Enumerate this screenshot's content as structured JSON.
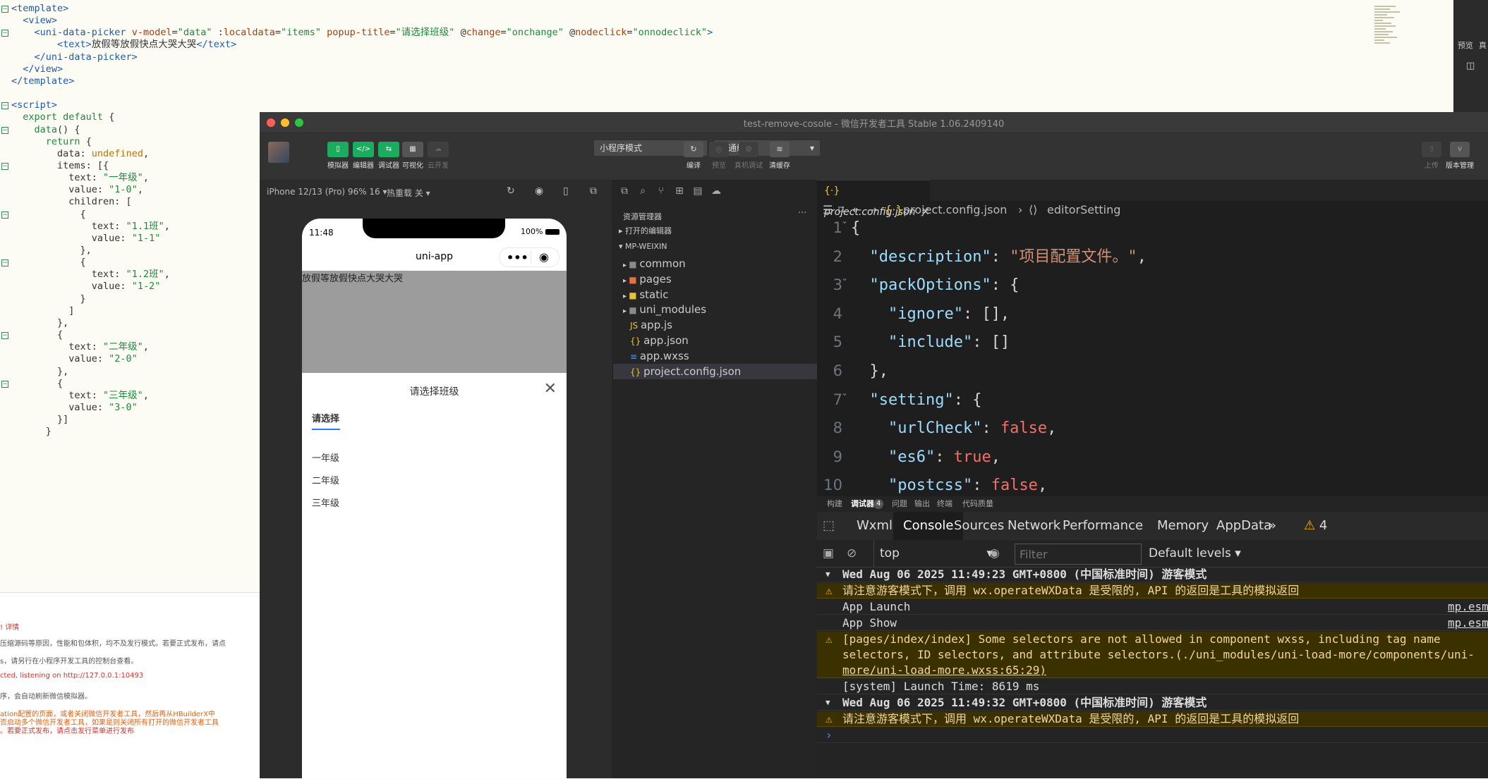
{
  "background_editor": {
    "lines": [
      {
        "parts": [
          [
            "tag",
            "<template>"
          ]
        ]
      },
      {
        "parts": [
          [
            "plain",
            "  "
          ],
          [
            "tag",
            "<view>"
          ]
        ]
      },
      {
        "parts": [
          [
            "plain",
            "    "
          ],
          [
            "tag",
            "<uni-data-picker "
          ],
          [
            "attr",
            "v-model"
          ],
          [
            "plain",
            "="
          ],
          [
            "str",
            "\"data\""
          ],
          [
            "plain",
            " :"
          ],
          [
            "attr",
            "localdata"
          ],
          [
            "plain",
            "="
          ],
          [
            "str",
            "\"items\""
          ],
          [
            "plain",
            " "
          ],
          [
            "attr",
            "popup-title"
          ],
          [
            "plain",
            "="
          ],
          [
            "str",
            "\"请选择班级\""
          ],
          [
            "plain",
            " @"
          ],
          [
            "attr",
            "change"
          ],
          [
            "plain",
            "="
          ],
          [
            "str",
            "\"onchange\""
          ],
          [
            "plain",
            " @"
          ],
          [
            "attr",
            "nodeclick"
          ],
          [
            "plain",
            "="
          ],
          [
            "str",
            "\"onnodeclick\""
          ],
          [
            "tag",
            ">"
          ]
        ]
      },
      {
        "parts": [
          [
            "plain",
            "        "
          ],
          [
            "tag",
            "<text>"
          ],
          [
            "plain",
            "放假等放假快点大哭大哭"
          ],
          [
            "tag",
            "</text>"
          ]
        ]
      },
      {
        "parts": [
          [
            "plain",
            "    "
          ],
          [
            "tag",
            "</uni-data-picker>"
          ]
        ]
      },
      {
        "parts": [
          [
            "plain",
            "  "
          ],
          [
            "tag",
            "</view>"
          ]
        ]
      },
      {
        "parts": [
          [
            "tag",
            "</template>"
          ]
        ]
      },
      {
        "parts": [
          [
            "plain",
            ""
          ]
        ]
      },
      {
        "parts": [
          [
            "tag",
            "<script>"
          ]
        ]
      },
      {
        "parts": [
          [
            "plain",
            "  "
          ],
          [
            "kw",
            "export default"
          ],
          [
            "plain",
            " {"
          ]
        ]
      },
      {
        "parts": [
          [
            "plain",
            "    "
          ],
          [
            "kw",
            "data"
          ],
          [
            "plain",
            "() {"
          ]
        ]
      },
      {
        "parts": [
          [
            "plain",
            "      "
          ],
          [
            "kw",
            "return"
          ],
          [
            "plain",
            " {"
          ]
        ]
      },
      {
        "parts": [
          [
            "plain",
            "        data: "
          ],
          [
            "val",
            "undefined"
          ],
          [
            "plain",
            ","
          ]
        ]
      },
      {
        "parts": [
          [
            "plain",
            "        items: [{"
          ]
        ]
      },
      {
        "parts": [
          [
            "plain",
            "          text: "
          ],
          [
            "str",
            "\"一年级\""
          ],
          [
            "plain",
            ","
          ]
        ]
      },
      {
        "parts": [
          [
            "plain",
            "          value: "
          ],
          [
            "str",
            "\"1-0\""
          ],
          [
            "plain",
            ","
          ]
        ]
      },
      {
        "parts": [
          [
            "plain",
            "          children: ["
          ]
        ]
      },
      {
        "parts": [
          [
            "plain",
            "            {"
          ]
        ]
      },
      {
        "parts": [
          [
            "plain",
            "              text: "
          ],
          [
            "str",
            "\"1.1班\""
          ],
          [
            "plain",
            ","
          ]
        ]
      },
      {
        "parts": [
          [
            "plain",
            "              value: "
          ],
          [
            "str",
            "\"1-1\""
          ]
        ]
      },
      {
        "parts": [
          [
            "plain",
            "            },"
          ]
        ]
      },
      {
        "parts": [
          [
            "plain",
            "            {"
          ]
        ]
      },
      {
        "parts": [
          [
            "plain",
            "              text: "
          ],
          [
            "str",
            "\"1.2班\""
          ],
          [
            "plain",
            ","
          ]
        ]
      },
      {
        "parts": [
          [
            "plain",
            "              value: "
          ],
          [
            "str",
            "\"1-2\""
          ]
        ]
      },
      {
        "parts": [
          [
            "plain",
            "            }"
          ]
        ]
      },
      {
        "parts": [
          [
            "plain",
            "          ]"
          ]
        ]
      },
      {
        "parts": [
          [
            "plain",
            "        },"
          ]
        ]
      },
      {
        "parts": [
          [
            "plain",
            "        {"
          ]
        ]
      },
      {
        "parts": [
          [
            "plain",
            "          text: "
          ],
          [
            "str",
            "\"二年级\""
          ],
          [
            "plain",
            ","
          ]
        ]
      },
      {
        "parts": [
          [
            "plain",
            "          value: "
          ],
          [
            "str",
            "\"2-0\""
          ]
        ]
      },
      {
        "parts": [
          [
            "plain",
            "        },"
          ]
        ]
      },
      {
        "parts": [
          [
            "plain",
            "        {"
          ]
        ]
      },
      {
        "parts": [
          [
            "plain",
            "          text: "
          ],
          [
            "str",
            "\"三年级\""
          ],
          [
            "plain",
            ","
          ]
        ]
      },
      {
        "parts": [
          [
            "plain",
            "          value: "
          ],
          [
            "str",
            "\"3-0\""
          ]
        ]
      },
      {
        "parts": [
          [
            "plain",
            "        }]"
          ]
        ]
      },
      {
        "parts": [
          [
            "plain",
            "      }"
          ]
        ]
      }
    ],
    "console_lines": [
      {
        "text": "! 详情",
        "color": "#d0342c"
      },
      {
        "text": "压缩源码等原因，性能和包体积，均不及发行模式。若要正式发布，请点",
        "color": "#555"
      },
      {
        "text": "s，请另行在小程序开发工具的控制台查看。",
        "color": "#555"
      },
      {
        "text": "cted, listening on http://127.0.0.1:10493",
        "color": "#d0342c"
      },
      {
        "text": "序，会自动刷新微信模拟器。",
        "color": "#555"
      },
      {
        "text": "ation配置的页面，或者关闭微信开发者工具，然后再从HBuilderX中",
        "color": "#e06010"
      },
      {
        "text": "否启动多个微信开发者工具，如果是则关闭所有打开的微信开发者工具",
        "color": "#e06010"
      },
      {
        "text": "。若要正式发布，请点击发行菜单进行发布",
        "color": "#d0342c"
      }
    ],
    "right_strip": {
      "label1": "预览",
      "label2": "真"
    }
  },
  "window": {
    "title": "test-remove-cosole - 微信开发者工具 Stable 1.06.2409140",
    "toolbar": {
      "buttons": [
        {
          "icon": "phone-icon",
          "label": "模拟器"
        },
        {
          "icon": "code-icon",
          "label": "编辑器"
        },
        {
          "icon": "debug-icon",
          "label": "调试器"
        },
        {
          "icon": "layout-icon",
          "label": "可视化"
        },
        {
          "icon": "cloud-icon",
          "label": "云开发"
        }
      ],
      "mode_select": "小程序模式",
      "compile_select": "普通编译",
      "right_buttons": [
        {
          "icon": "refresh-icon",
          "label": "编译"
        },
        {
          "icon": "eye-icon",
          "label": "预览"
        },
        {
          "icon": "bug-icon",
          "label": "真机调试"
        },
        {
          "icon": "layers-icon",
          "label": "清缓存"
        }
      ],
      "far_right_buttons": [
        {
          "icon": "upload-icon",
          "label": "上传"
        },
        {
          "icon": "branch-icon",
          "label": "版本管理"
        }
      ]
    },
    "simulator": {
      "device": "iPhone 12/13 (Pro) 96% 16 ▾",
      "hot_reload": "热重载 关 ▾",
      "phone": {
        "time": "11:48",
        "battery": "100%",
        "nav_title": "uni-app",
        "content_text": "放假等放假快点大哭大哭",
        "popup_title": "请选择班级",
        "popup_tab": "请选择",
        "popup_items": [
          "一年级",
          "二年级",
          "三年级"
        ]
      }
    },
    "explorer": {
      "title": "资源管理器",
      "open_editors": "打开的编辑器",
      "project": "MP-WEIXIN",
      "items": [
        {
          "name": "common",
          "kind": "folder",
          "color": "#8a8a8a"
        },
        {
          "name": "pages",
          "kind": "folder",
          "color": "#e8703a"
        },
        {
          "name": "static",
          "kind": "folder",
          "color": "#e8c03a"
        },
        {
          "name": "uni_modules",
          "kind": "folder",
          "color": "#8a8a8a"
        },
        {
          "name": "app.js",
          "kind": "js",
          "color": "#e8c03a"
        },
        {
          "name": "app.json",
          "kind": "json",
          "color": "#e8c03a"
        },
        {
          "name": "app.wxss",
          "kind": "css",
          "color": "#4a9ae8"
        },
        {
          "name": "project.config.json",
          "kind": "json",
          "color": "#e8c03a"
        }
      ]
    },
    "editor": {
      "tab": "project.config.json",
      "crumb_file": "project.config.json",
      "crumb_sep": "›",
      "crumb_node": "editorSetting",
      "lines": [
        {
          "n": "1",
          "parts": [
            [
              "punc",
              "{"
            ]
          ]
        },
        {
          "n": "2",
          "parts": [
            [
              "punc",
              "  "
            ],
            [
              "key",
              "\"description\""
            ],
            [
              "punc",
              ": "
            ],
            [
              "str",
              "\"项目配置文件。\""
            ],
            [
              "punc",
              ","
            ]
          ]
        },
        {
          "n": "3",
          "parts": [
            [
              "punc",
              "  "
            ],
            [
              "key",
              "\"packOptions\""
            ],
            [
              "punc",
              ": {"
            ]
          ]
        },
        {
          "n": "4",
          "parts": [
            [
              "punc",
              "    "
            ],
            [
              "key",
              "\"ignore\""
            ],
            [
              "punc",
              ": [],"
            ]
          ]
        },
        {
          "n": "5",
          "parts": [
            [
              "punc",
              "    "
            ],
            [
              "key",
              "\"include\""
            ],
            [
              "punc",
              ": []"
            ]
          ]
        },
        {
          "n": "6",
          "parts": [
            [
              "punc",
              "  },"
            ]
          ]
        },
        {
          "n": "7",
          "parts": [
            [
              "punc",
              "  "
            ],
            [
              "key",
              "\"setting\""
            ],
            [
              "punc",
              ": {"
            ]
          ]
        },
        {
          "n": "8",
          "parts": [
            [
              "punc",
              "    "
            ],
            [
              "key",
              "\"urlCheck\""
            ],
            [
              "punc",
              ": "
            ],
            [
              "red",
              "false"
            ],
            [
              "punc",
              ","
            ]
          ]
        },
        {
          "n": "9",
          "parts": [
            [
              "punc",
              "    "
            ],
            [
              "key",
              "\"es6\""
            ],
            [
              "punc",
              ": "
            ],
            [
              "red",
              "true"
            ],
            [
              "punc",
              ","
            ]
          ]
        },
        {
          "n": "10",
          "parts": [
            [
              "punc",
              "    "
            ],
            [
              "key",
              "\"postcss\""
            ],
            [
              "punc",
              ": "
            ],
            [
              "red",
              "false"
            ],
            [
              "punc",
              ","
            ]
          ]
        }
      ]
    },
    "devtools": {
      "subtabs": [
        "构建",
        "调试器",
        "问题",
        "输出",
        "终端",
        "代码质量"
      ],
      "debugger_badge": "4",
      "tabs": [
        "Wxml",
        "Console",
        "Sources",
        "Network",
        "Performance",
        "Memory",
        "AppData"
      ],
      "more": "»",
      "warn_count": "4",
      "context": "top",
      "filter_placeholder": "Filter",
      "levels": "Default levels ▾",
      "logs": [
        {
          "type": "group",
          "text": "Wed Aug 06 2025 11:49:23 GMT+0800 (中国标准时间) 游客模式"
        },
        {
          "type": "warn",
          "text": "请注意游客模式下，调用 wx.operateWXData 是受限的, API 的返回是工具的模拟返回"
        },
        {
          "type": "info",
          "text": "App Launch",
          "src": "mp.esm.j"
        },
        {
          "type": "info",
          "text": "App Show",
          "src": "mp.esm.j"
        },
        {
          "type": "warn-multi",
          "text": "[pages/index/index] Some selectors are not allowed in component wxss, including tag name",
          "text2": "selectors, ID selectors, and attribute selectors.(./uni_modules/uni-load-more/components/uni-",
          "text3": "more/uni-load-more.wxss:65:29)"
        },
        {
          "type": "info",
          "text": "[system] Launch Time: 8619 ms"
        },
        {
          "type": "group",
          "text": "Wed Aug 06 2025 11:49:32 GMT+0800 (中国标准时间) 游客模式"
        },
        {
          "type": "warn",
          "text": "请注意游客模式下，调用 wx.operateWXData 是受限的, API 的返回是工具的模拟返回"
        },
        {
          "type": "prompt",
          "text": "›"
        }
      ]
    }
  }
}
